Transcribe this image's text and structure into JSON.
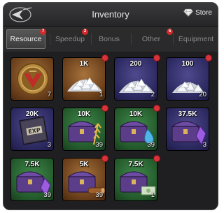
{
  "header": {
    "title": "Inventory",
    "store_label": "Store"
  },
  "tabs": [
    {
      "label": "Resource",
      "badge": "7",
      "active": true
    },
    {
      "label": "Speedup",
      "badge": "2"
    },
    {
      "label": "Bonus"
    },
    {
      "label": "Other",
      "badge": "5"
    },
    {
      "label": "Equipment"
    }
  ],
  "items": [
    {
      "kind": "medal",
      "amount": "",
      "count": "7",
      "bg": "brown",
      "new": false
    },
    {
      "kind": "diamonds",
      "amount": "1K",
      "count": "1",
      "bg": "brown",
      "new": true
    },
    {
      "kind": "diamonds",
      "amount": "200",
      "count": "2",
      "bg": "purple",
      "new": true
    },
    {
      "kind": "diamonds",
      "amount": "100",
      "count": "20",
      "bg": "purple",
      "new": true
    },
    {
      "kind": "exp-book",
      "amount": "20K",
      "count": "3",
      "bg": "purple",
      "new": false
    },
    {
      "kind": "chest-wheat",
      "amount": "10K",
      "count": "39",
      "bg": "green",
      "new": true
    },
    {
      "kind": "chest-water",
      "amount": "10K",
      "count": "39",
      "bg": "green",
      "new": true
    },
    {
      "kind": "chest-gem",
      "amount": "37.5K",
      "count": "3",
      "bg": "purple",
      "new": false
    },
    {
      "kind": "chest-gem",
      "amount": "7.5K",
      "count": "39",
      "bg": "green",
      "new": false
    },
    {
      "kind": "chest-wood",
      "amount": "5K",
      "count": "39",
      "bg": "brown",
      "new": true
    },
    {
      "kind": "chest-cash",
      "amount": "7.5K",
      "count": "1",
      "bg": "green",
      "new": true
    }
  ],
  "colors": {
    "badge": "#d42a2a",
    "panel": "#262628"
  }
}
